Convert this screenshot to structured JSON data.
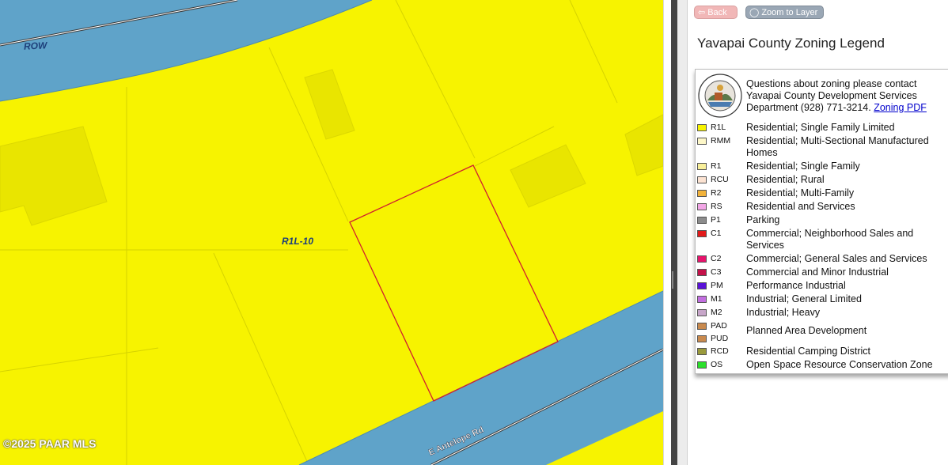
{
  "map": {
    "labels": {
      "row": "ROW",
      "zone": "R1L-10",
      "road": "E Antelope Rd"
    },
    "copyright": "©2025 PAAR MLS",
    "colors": {
      "zone_fill": "#f7f300",
      "road": "#5fa3c9",
      "parcel_outline": "#d0202e"
    }
  },
  "toolbar": {
    "back_label": "Back",
    "zoom_label": "Zoom to Layer"
  },
  "legend": {
    "title": "Yavapai County Zoning Legend",
    "contact_text": "Questions about zoning please contact Yavapai County Development Services Department (928) 771-3214.",
    "pdf_link": "Zoning PDF",
    "items": [
      {
        "code": "R1L",
        "label": "Residential; Single Family Limited",
        "color": "#f7f300"
      },
      {
        "code": "RMM",
        "label": "Residential; Multi-Sectional Manufactured Homes",
        "color": "#fdf7c8"
      },
      {
        "code": "R1",
        "label": "Residential; Single Family",
        "color": "#f8ef9a"
      },
      {
        "code": "RCU",
        "label": "Residential; Rural",
        "color": "#fce3d2"
      },
      {
        "code": "R2",
        "label": "Residential; Multi-Family",
        "color": "#f2b33b"
      },
      {
        "code": "RS",
        "label": "Residential and Services",
        "color": "#f2a6e6"
      },
      {
        "code": "P1",
        "label": "Parking",
        "color": "#8c8c8c"
      },
      {
        "code": "C1",
        "label": "Commercial; Neighborhood Sales and Services",
        "color": "#e21a1a"
      },
      {
        "code": "C2",
        "label": "Commercial; General Sales and Services",
        "color": "#e8136c"
      },
      {
        "code": "C3",
        "label": "Commercial and Minor Industrial",
        "color": "#c4124a"
      },
      {
        "code": "PM",
        "label": "Performance Industrial",
        "color": "#5a12d8"
      },
      {
        "code": "M1",
        "label": "Industrial; General Limited",
        "color": "#c26ee0"
      },
      {
        "code": "M2",
        "label": "Industrial; Heavy",
        "color": "#c7a6c9"
      },
      {
        "code": "PAD",
        "label": "",
        "color": "#c98a4e"
      },
      {
        "code": "PUD",
        "label": "Planned Area Development",
        "color": "#c98a4e"
      },
      {
        "code": "RCD",
        "label": "Residential Camping District",
        "color": "#9a9a3c"
      },
      {
        "code": "OS",
        "label": "Open Space Resource Conservation Zone",
        "color": "#2be02b"
      }
    ]
  }
}
